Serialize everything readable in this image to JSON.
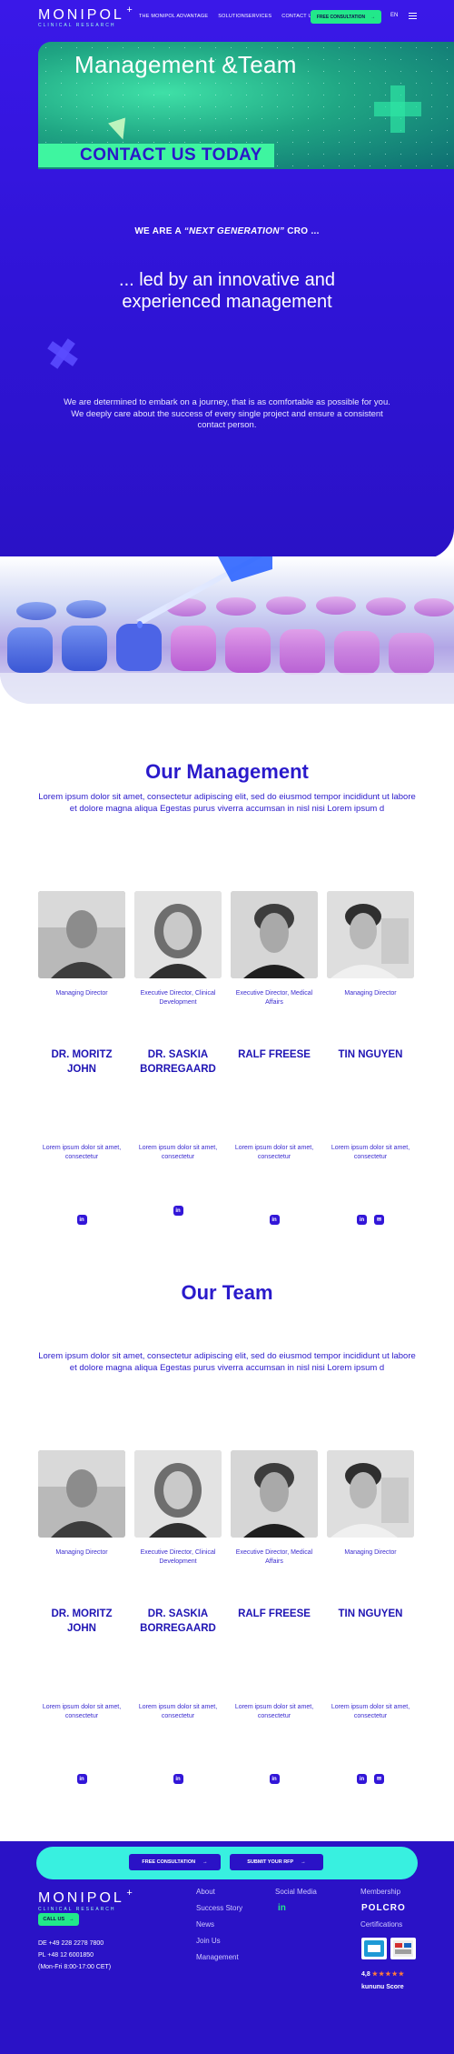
{
  "nav": {
    "logo": "MONIPOL",
    "logo_sub": "CLINICAL RESEARCH",
    "links": [
      "THE MONIPOL ADVANTAGE",
      "SOLUTIONSERVICES",
      "CONTACT US"
    ],
    "cta": "FREE CONSULTATION",
    "cta_arrow": "→",
    "language": "EN"
  },
  "banner": {
    "title": "Management &Team",
    "cta": "CONTACT US TODAY"
  },
  "intro": {
    "eyebrow_prefix": "WE ARE A ",
    "eyebrow_emphasis": "“NEXT GENERATION”",
    "eyebrow_suffix": " CRO ...",
    "headline": "... led by an innovative and experienced management",
    "paragraph": "We are determined to embark on a journey, that is as comfortable as possible for you. We deeply care about the success of every single project and ensure a consistent contact person."
  },
  "management": {
    "title": "Our Management",
    "paragraph": "Lorem ipsum dolor sit amet, consectetur adipiscing elit, sed do eiusmod tempor incididunt ut labore et dolore magna aliqua Egestas purus viverra accumsan in nisl nisi Lorem ipsum d",
    "people": [
      {
        "role": "Managing Director",
        "name": "DR. MORITZ JOHN",
        "bio": "Lorem ipsum dolor sit amet, consectetur",
        "socials": [
          "in"
        ]
      },
      {
        "role": "Executive Director, Clinical Development",
        "name": "DR. SASKIA BORREGAARD",
        "bio": "Lorem ipsum dolor sit amet, consectetur",
        "socials": [
          "in"
        ]
      },
      {
        "role": "Executive Director, Medical Affairs",
        "name": "RALF FREESE",
        "bio": "Lorem ipsum dolor sit amet, consectetur",
        "socials": [
          "in"
        ]
      },
      {
        "role": "Managing Director",
        "name": "TIN NGUYEN",
        "bio": "Lorem ipsum dolor sit amet, consectetur",
        "socials": [
          "in",
          "✉"
        ]
      }
    ]
  },
  "team": {
    "title": "Our Team",
    "paragraph": "Lorem ipsum dolor sit amet, consectetur adipiscing elit, sed do eiusmod tempor incididunt ut labore et dolore magna aliqua Egestas purus viverra accumsan in nisl nisi Lorem ipsum d",
    "people": [
      {
        "role": "Managing Director",
        "name": "DR. MORITZ JOHN",
        "bio": "Lorem ipsum dolor sit amet, consectetur",
        "socials": [
          "in"
        ]
      },
      {
        "role": "Executive Director, Clinical Development",
        "name": "DR. SASKIA BORREGAARD",
        "bio": "Lorem ipsum dolor sit amet, consectetur",
        "socials": [
          "in"
        ]
      },
      {
        "role": "Executive Director, Medical Affairs",
        "name": "RALF FREESE",
        "bio": "Lorem ipsum dolor sit amet, consectetur",
        "socials": [
          "in"
        ]
      },
      {
        "role": "Managing Director",
        "name": "TIN NGUYEN",
        "bio": "Lorem ipsum dolor sit amet, consectetur",
        "socials": [
          "in",
          "✉"
        ]
      }
    ]
  },
  "footer": {
    "cta_consultation": "FREE CONSULTATION",
    "cta_rfp": "SUBMIT YOUR RFP",
    "arrow": "→",
    "logo": "MONIPOL",
    "logo_sub": "CLINICAL RESEARCH",
    "call_us": "CALL US",
    "phone_de": "DE +49 228 2278 7800",
    "phone_pl": "PL +48 12 6001850",
    "hours": "(Mon-Fri 8:00-17:00 CET)",
    "links": [
      "About",
      "Success Story",
      "News",
      "Join Us",
      "Management"
    ],
    "social_heading": "Social Media",
    "social_icon": "in",
    "membership_heading": "Membership",
    "membership_logo": "POLCRO",
    "certifications_heading": "Certifications",
    "rating": "4,8",
    "stars": "★★★★★",
    "rating_label": "kununu Score"
  },
  "colors": {
    "brand_blue": "#2a12c6",
    "accent_green": "#22e88a",
    "accent_cyan": "#38f0e0"
  },
  "icons": [
    "linkedin-icon",
    "email-icon",
    "arrow-right-icon",
    "menu-icon",
    "phone-icon"
  ]
}
